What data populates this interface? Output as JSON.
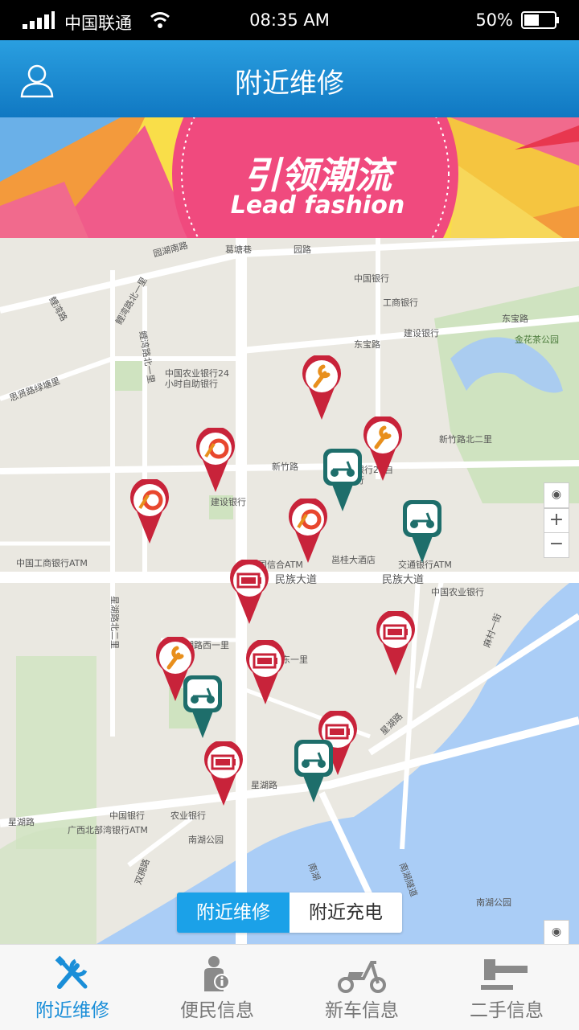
{
  "status": {
    "carrier": "中国联通",
    "time": "08:35 AM",
    "battery": "50%"
  },
  "header": {
    "title": "附近维修"
  },
  "banner": {
    "cn": "引领潮流",
    "en": "Lead fashion"
  },
  "map": {
    "labels": [
      "园湖南路",
      "葛塘巷",
      "园路",
      "中国银行",
      "工商银行",
      "建设银行",
      "东宝路",
      "东宝路",
      "金花茶公园",
      "鲤湾路",
      "鲤湾路北一里",
      "鲤湾路北一里",
      "中国农业银行24小时自助银行",
      "思贤路绿塘里",
      "新竹路北二里",
      "新竹路",
      "中国银行24自助银行",
      "建设银行",
      "中国工商银行ATM",
      "中国信合ATM",
      "邕桂大酒店",
      "交通银行ATM",
      "民族大道",
      "民族大道",
      "中国农业银行",
      "星湖路北二里",
      "湖路西一里",
      "东一里",
      "星湖路",
      "麻村一街",
      "星湖路",
      "中国银行",
      "农业银行",
      "广西北部湾银行ATM",
      "南湖公园",
      "南湖",
      "南湖隧道",
      "南湖公园",
      "星湖路",
      "双拥路"
    ],
    "toggle": {
      "repair": "附近维修",
      "charge": "附近充电"
    },
    "zoom_in": "+",
    "zoom_out": "−"
  },
  "tabs": [
    {
      "label": "附近维修",
      "active": true
    },
    {
      "label": "便民信息",
      "active": false
    },
    {
      "label": "新车信息",
      "active": false
    },
    {
      "label": "二手信息",
      "active": false
    }
  ],
  "colors": {
    "header": "#1a8ed8",
    "pin_red": "#c8233a",
    "pin_teal": "#1e6e6b",
    "toggle_active": "#1ba1e8"
  }
}
